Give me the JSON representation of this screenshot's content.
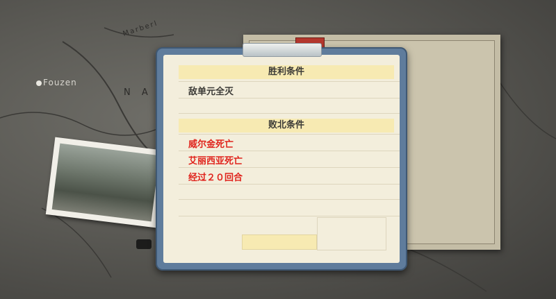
{
  "background": {
    "map_labels": [
      "Fouzen",
      "N  A",
      "Marberl"
    ]
  },
  "dialog": {
    "victory": {
      "header": "胜利条件",
      "conditions": [
        "敌单元全灭"
      ]
    },
    "defeat": {
      "header": "败北条件",
      "conditions": [
        "威尔金死亡",
        "艾丽西亚死亡",
        "经过２０回合"
      ]
    }
  },
  "colors": {
    "dialog_frame": "#5f7c9c",
    "paper": "#f3eedc",
    "header_band": "#f7eab2",
    "victory_text": "#3b3a36",
    "defeat_text": "#e0231c"
  }
}
